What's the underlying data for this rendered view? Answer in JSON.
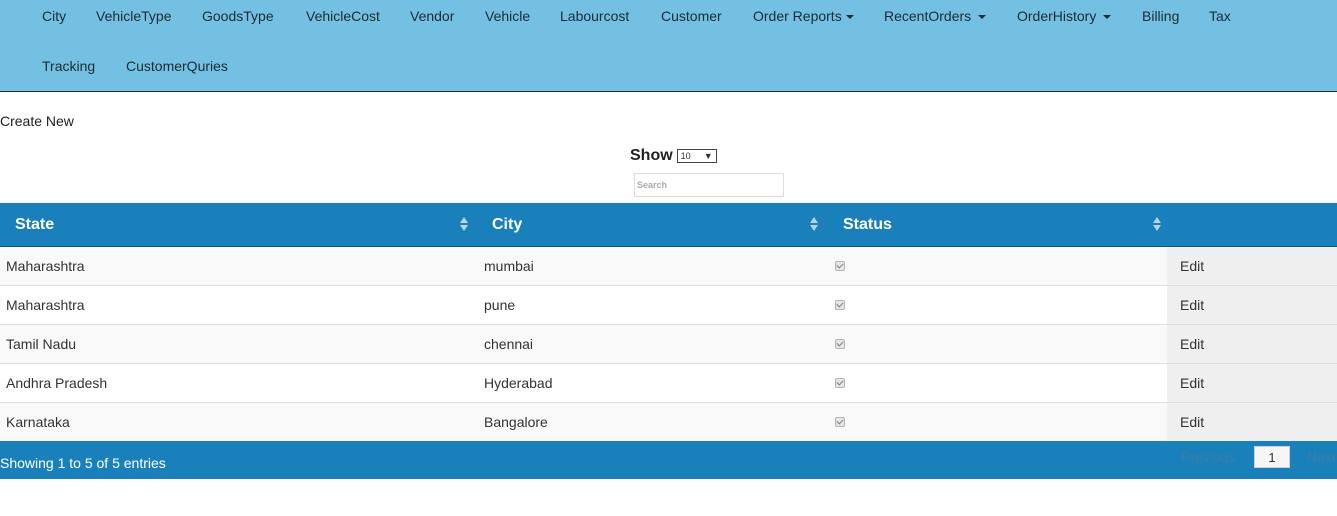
{
  "nav": {
    "row1": [
      {
        "label": "City",
        "dropdown": false
      },
      {
        "label": "VehicleType",
        "dropdown": false
      },
      {
        "label": "GoodsType",
        "dropdown": false
      },
      {
        "label": "VehicleCost",
        "dropdown": false
      },
      {
        "label": "Vendor",
        "dropdown": false
      },
      {
        "label": "Vehicle",
        "dropdown": false
      },
      {
        "label": "Labourcost",
        "dropdown": false
      },
      {
        "label": "Customer",
        "dropdown": false
      },
      {
        "label": "Order Reports",
        "dropdown": true
      },
      {
        "label": "RecentOrders",
        "dropdown": true
      },
      {
        "label": "OrderHistory",
        "dropdown": true
      },
      {
        "label": "Billing",
        "dropdown": false
      },
      {
        "label": "Tax",
        "dropdown": false
      }
    ],
    "row2": [
      {
        "label": "Tracking",
        "dropdown": false
      },
      {
        "label": "CustomerQuries",
        "dropdown": false
      }
    ]
  },
  "create_new": "Create New",
  "length_menu": {
    "label": "Show",
    "selected": "10"
  },
  "search": {
    "placeholder": "Search"
  },
  "table": {
    "columns": [
      "State",
      "City",
      "Status",
      ""
    ],
    "rows": [
      {
        "state": "Maharashtra",
        "city": "mumbai",
        "status": true,
        "action": "Edit"
      },
      {
        "state": "Maharashtra",
        "city": "pune",
        "status": true,
        "action": "Edit"
      },
      {
        "state": "Tamil Nadu",
        "city": "chennai",
        "status": true,
        "action": "Edit"
      },
      {
        "state": "Andhra Pradesh",
        "city": "Hyderabad",
        "status": true,
        "action": "Edit"
      },
      {
        "state": "Karnataka",
        "city": "Bangalore",
        "status": true,
        "action": "Edit"
      }
    ]
  },
  "footer": {
    "info": "Showing 1 to 5 of 5 entries",
    "previous": "Previous",
    "page": "1",
    "next": "Next"
  },
  "colors": {
    "navbar": "#73c0e2",
    "table_header": "#1a80bb"
  }
}
